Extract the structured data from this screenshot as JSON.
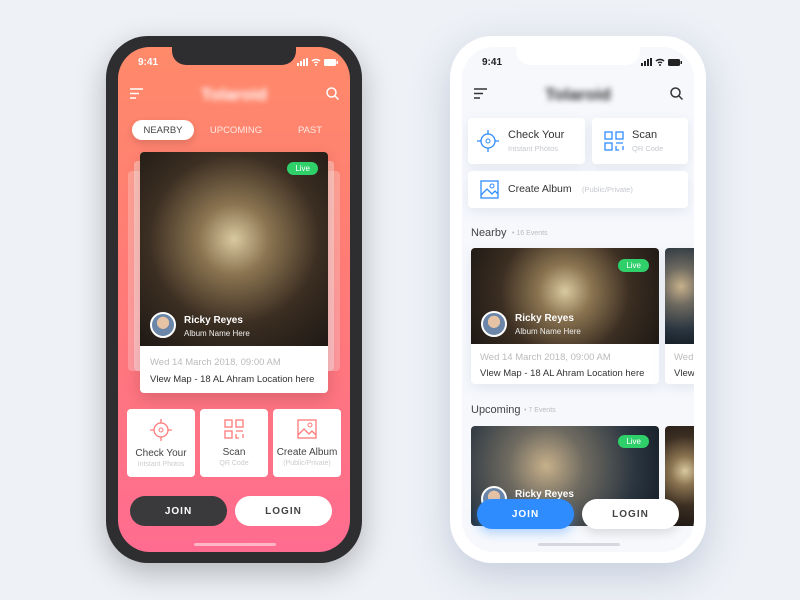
{
  "left_phone": {
    "status_time": "9:41",
    "app_title": "Tolaroid",
    "tabs": [
      {
        "label": "NEARBY",
        "active": true
      },
      {
        "label": "UPCOMING"
      },
      {
        "label": "PAST"
      }
    ],
    "event": {
      "badge": "Live",
      "name": "Ricky Reyes",
      "album": "Album Name Here",
      "date": "Wed 14 March 2018, 09:00 AM",
      "location": "Vlew Map - 18 AL Ahram Location here"
    },
    "actions": [
      {
        "title": "Check Your",
        "subtitle": "Intstant Photos",
        "icon": "crosshair-icon"
      },
      {
        "title": "Scan",
        "subtitle": "QR Code",
        "icon": "qr-code-icon"
      },
      {
        "title": "Create Album",
        "subtitle": "(Public/Private)",
        "icon": "image-icon"
      }
    ],
    "join": "JOIN",
    "login": "LOGIN"
  },
  "right_phone": {
    "status_time": "9:41",
    "app_title": "Tolaroid",
    "actions": [
      {
        "title": "Check Your",
        "subtitle": "Intstant Photos",
        "icon": "crosshair-icon"
      },
      {
        "title": "Scan",
        "subtitle": "QR Code",
        "icon": "qr-code-icon"
      },
      {
        "title": "Create Album",
        "subtitle": "(Public/Private)",
        "icon": "image-icon"
      }
    ],
    "nearby": {
      "heading": "Nearby",
      "count": "16 Events",
      "card": {
        "badge": "Live",
        "name": "Ricky Reyes",
        "album": "Album Name Here",
        "date": "Wed 14 March 2018, 09:00 AM",
        "location": "Vlew Map - 18 AL Ahram Location here"
      },
      "peek_date": "Wed",
      "peek_location": "Vlew"
    },
    "upcoming": {
      "heading": "Upcoming",
      "count": "7 Events",
      "card": {
        "badge": "Live",
        "name": "Ricky Reyes"
      }
    },
    "join": "JOIN",
    "login": "LOGIN"
  },
  "colors": {
    "accent_left": "#ff7a78",
    "accent_right": "#2f8cff",
    "live": "#2fd06a"
  }
}
